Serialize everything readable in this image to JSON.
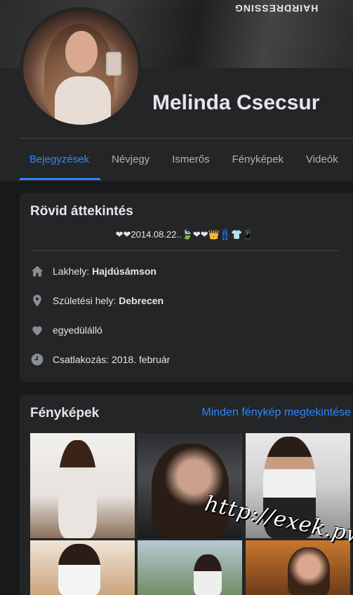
{
  "cover": {
    "text": "HAIRDRESSING"
  },
  "profile": {
    "name": "Melinda Csecsur"
  },
  "tabs": [
    {
      "label": "Bejegyzések",
      "active": true
    },
    {
      "label": "Névjegy"
    },
    {
      "label": "Ismerős"
    },
    {
      "label": "Fényképek"
    },
    {
      "label": "Videók"
    }
  ],
  "intro": {
    "title": "Rövid áttekintés",
    "bio": "❤❤2014.08.22..🍃❤❤👑👖👕📱",
    "rows": [
      {
        "icon": "home-icon",
        "label": "Lakhely:",
        "value": "Hajdúsámson"
      },
      {
        "icon": "location-pin-icon",
        "label": "Születési hely:",
        "value": "Debrecen"
      },
      {
        "icon": "heart-icon",
        "label": "egyedülálló",
        "value": ""
      },
      {
        "icon": "clock-icon",
        "label": "Csatlakozás: 2018. február",
        "value": ""
      }
    ]
  },
  "photos": {
    "title": "Fényképek",
    "see_all": "Minden fénykép megtekintése"
  },
  "watermark": "http://exek.pw",
  "colors": {
    "accent": "#2d88ff",
    "background": "#18191a",
    "card": "#242526"
  }
}
